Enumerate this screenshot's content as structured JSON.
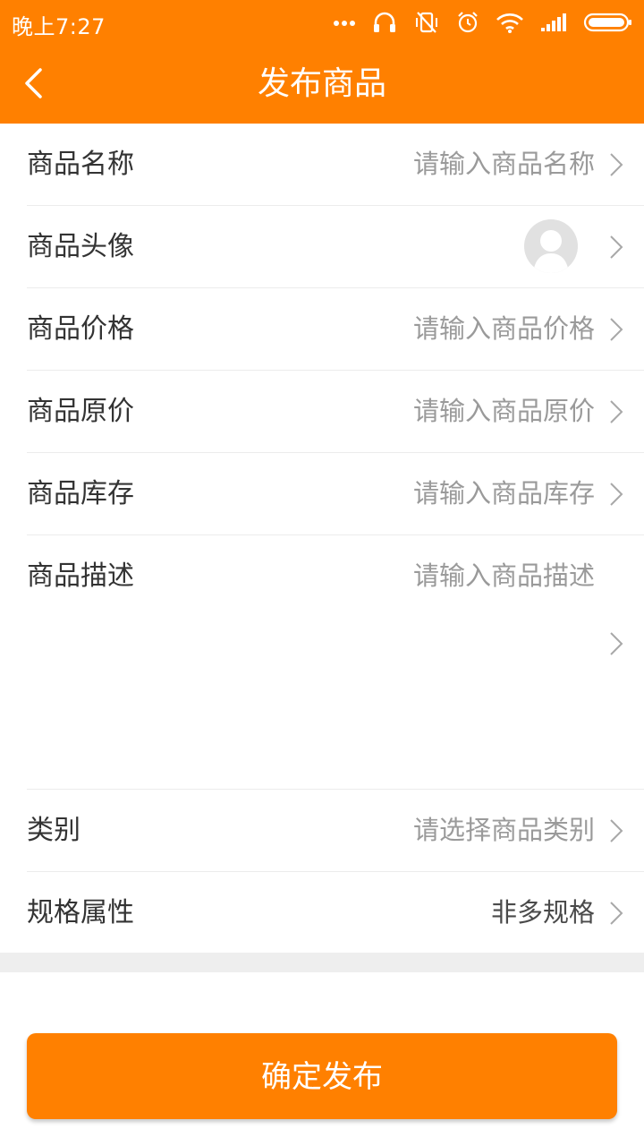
{
  "status_bar": {
    "time": "晚上7:27",
    "icons": [
      "more-dots-icon",
      "headphones-icon",
      "vibrate-off-icon",
      "alarm-icon",
      "wifi-icon",
      "signal-icon",
      "battery-icon"
    ]
  },
  "header": {
    "title": "发布商品",
    "back_icon": "chevron-left-icon"
  },
  "form": {
    "rows": [
      {
        "label": "商品名称",
        "placeholder": "请输入商品名称"
      },
      {
        "label": "商品头像",
        "value_icon": "default-avatar-icon"
      },
      {
        "label": "商品价格",
        "placeholder": "请输入商品价格"
      },
      {
        "label": "商品原价",
        "placeholder": "请输入商品原价"
      },
      {
        "label": "商品库存",
        "placeholder": "请输入商品库存"
      },
      {
        "label": "商品描述",
        "placeholder": "请输入商品描述"
      },
      {
        "label": "类别",
        "placeholder": "请选择商品类别"
      },
      {
        "label": "规格属性",
        "value": "非多规格"
      }
    ]
  },
  "footer": {
    "submit_label": "确定发布"
  },
  "colors": {
    "brand": "#ff8000",
    "placeholder_text": "#9a9a9a",
    "label_text": "#333333",
    "divider": "#ececec",
    "section_gap": "#eeeeee"
  }
}
